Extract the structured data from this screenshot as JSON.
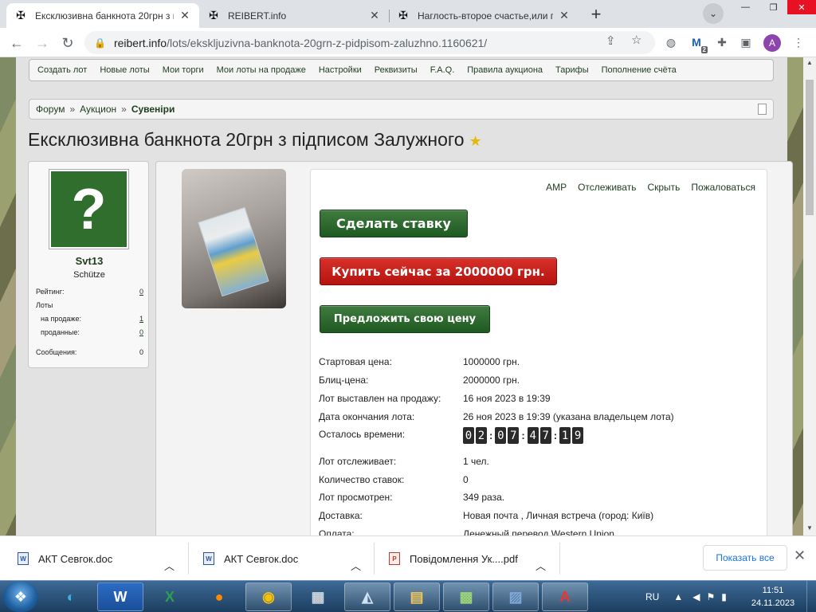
{
  "browser": {
    "tabs": [
      {
        "title": "Ексклюзивна банкнота 20грн з підписом Залужного",
        "active": true
      },
      {
        "title": "REIBERT.info",
        "active": false
      },
      {
        "title": "Наглость-второе счастье,или правда",
        "active": false
      }
    ],
    "url_host": "reibert.info",
    "url_path": "/lots/ekskljuzivna-banknota-20grn-z-pidpisom-zaluzhno.1160621/",
    "profile_initial": "A",
    "ext_badge": "2"
  },
  "site": {
    "nav": [
      "Создать лот",
      "Новые лоты",
      "Мои торги",
      "Мои лоты на продаже",
      "Настройки",
      "Реквизиты",
      "F.A.Q.",
      "Правила аукциона",
      "Тарифы",
      "Пополнение счёта"
    ],
    "breadcrumb": {
      "items": [
        "Форум",
        "Аукцион"
      ],
      "current": "Сувеніри",
      "separator": "»"
    },
    "lot_title": "Ексклюзивна банкнота 20грн з підписом Залужного"
  },
  "seller": {
    "name": "Svt13",
    "rank": "Schütze",
    "rating_label": "Рейтинг:",
    "rating": "0",
    "lots_label": "Лоты",
    "on_sale_label": "на продаже:",
    "on_sale": "1",
    "sold_label": "проданные:",
    "sold": "0",
    "messages_label": "Сообщения:",
    "messages": "0"
  },
  "lot": {
    "actions": [
      "AMP",
      "Отслеживать",
      "Скрыть",
      "Пожаловаться"
    ],
    "bid_button": "Сделать ставку",
    "buy_button": "Купить сейчас за 2000000 грн.",
    "offer_button": "Предложить свою цену",
    "info": [
      {
        "k": "Стартовая цена:",
        "v": "1000000 грн."
      },
      {
        "k": "Блиц-цена:",
        "v": "2000000 грн."
      },
      {
        "k": "Лот выставлен на продажу:",
        "v": "16 ноя 2023 в 19:39"
      },
      {
        "k": "Дата окончания лота:",
        "v": "26 ноя 2023 в 19:39 (указана владельцем лота)"
      }
    ],
    "time_left_label": "Осталось времени:",
    "time_left": [
      "0",
      "2",
      "0",
      "7",
      "4",
      "7",
      "1",
      "9"
    ],
    "info2": [
      {
        "k": "Лот отслеживает:",
        "v": "1 чел."
      },
      {
        "k": "Количество ставок:",
        "v": "0"
      },
      {
        "k": "Лот просмотрен:",
        "v": "349 раза."
      },
      {
        "k": "Доставка:",
        "v": "Новая почта , Личная встреча (город: Київ)"
      },
      {
        "k": "Оплата:",
        "v": "Денежный перевод Western Union"
      }
    ]
  },
  "downloads": {
    "items": [
      "АКТ Севгок.doc",
      "АКТ Севгок.doc",
      "Повідомлення Ук....pdf"
    ],
    "show_all": "Показать все"
  },
  "taskbar": {
    "lang": "RU",
    "time": "11:51",
    "date": "24.11.2023"
  },
  "colors": {
    "accent_green": "#2a6a2c",
    "buy_red": "#c8211c",
    "link": "#1e3c1e"
  }
}
